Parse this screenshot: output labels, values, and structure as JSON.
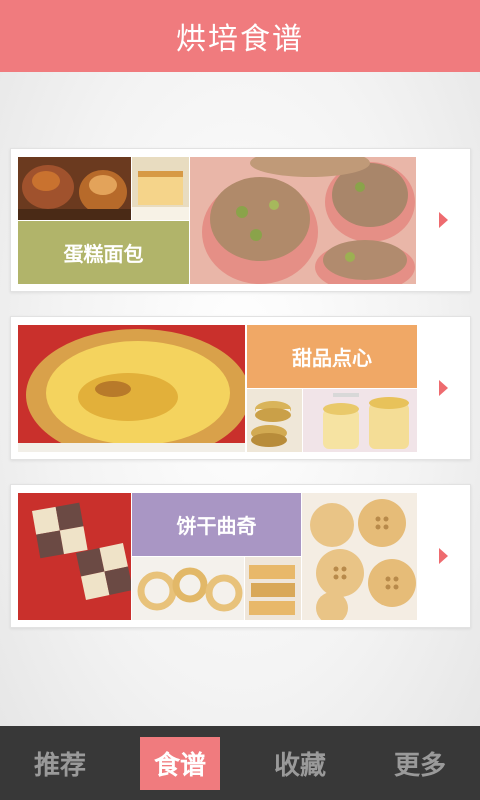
{
  "header": {
    "title": "烘培食谱"
  },
  "cards": [
    {
      "label": "蛋糕面包",
      "label_color": "#b1b46a"
    },
    {
      "label": "甜品点心",
      "label_color": "#f0a866"
    },
    {
      "label": "饼干曲奇",
      "label_color": "#a996c4"
    }
  ],
  "tabs": [
    {
      "label": "推荐"
    },
    {
      "label": "食谱"
    },
    {
      "label": "收藏"
    },
    {
      "label": "更多"
    }
  ],
  "active_tab": "食谱",
  "colors": {
    "brand": "#f07b7e",
    "tabbar": "#383838",
    "arrow": "#ee6b6f"
  }
}
